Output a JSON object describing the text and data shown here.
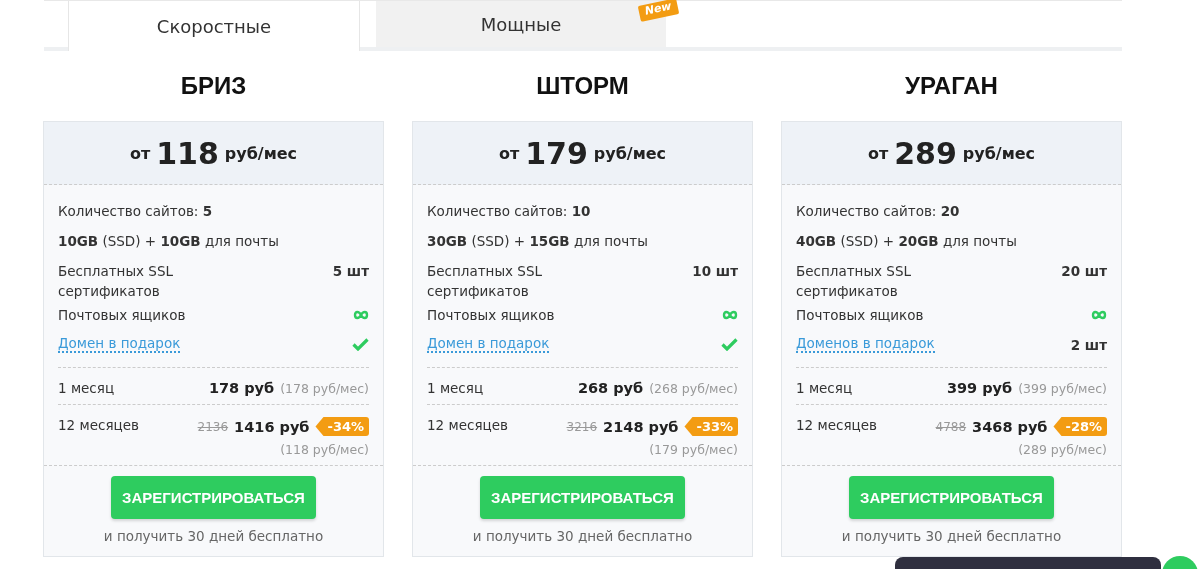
{
  "tabs": [
    {
      "label": "Скоростные",
      "selected": true
    },
    {
      "label": "Мощные",
      "selected": false,
      "badge": "New"
    }
  ],
  "plans": [
    {
      "name": "БРИЗ",
      "price_prefix": "от",
      "price": "118",
      "price_unit": "руб/мес",
      "features": [
        {
          "kind": "inline",
          "label": "Количество сайтов:",
          "value": "5"
        },
        {
          "kind": "text",
          "label": "**10GB** (SSD) + **10GB** для почты"
        },
        {
          "kind": "value",
          "label": "Бесплатных SSL сертификатов",
          "value": "5 шт"
        },
        {
          "kind": "infinity",
          "label": "Почтовых ящиков"
        },
        {
          "kind": "check",
          "label": "Домен в подарок",
          "link": true
        }
      ],
      "month": {
        "label": "1 месяц",
        "price": "178 руб",
        "per_month": "(178 руб/мес)"
      },
      "year": {
        "label": "12 месяцев",
        "old_price": "2136",
        "price": "1416 руб",
        "discount": "-34%",
        "per_month": "(118 руб/мес)"
      },
      "button": "ЗАРЕГИСТРИРОВАТЬСЯ",
      "note": "и получить 30 дней бесплатно"
    },
    {
      "name": "ШТОРМ",
      "price_prefix": "от",
      "price": "179",
      "price_unit": "руб/мес",
      "features": [
        {
          "kind": "inline",
          "label": "Количество сайтов:",
          "value": "10"
        },
        {
          "kind": "text",
          "label": "**30GB** (SSD) + **15GB** для почты"
        },
        {
          "kind": "value",
          "label": "Бесплатных SSL сертификатов",
          "value": "10 шт"
        },
        {
          "kind": "infinity",
          "label": "Почтовых ящиков"
        },
        {
          "kind": "check",
          "label": "Домен в подарок",
          "link": true
        }
      ],
      "month": {
        "label": "1 месяц",
        "price": "268 руб",
        "per_month": "(268 руб/мес)"
      },
      "year": {
        "label": "12 месяцев",
        "old_price": "3216",
        "price": "2148 руб",
        "discount": "-33%",
        "per_month": "(179 руб/мес)"
      },
      "button": "ЗАРЕГИСТРИРОВАТЬСЯ",
      "note": "и получить 30 дней бесплатно"
    },
    {
      "name": "УРАГАН",
      "price_prefix": "от",
      "price": "289",
      "price_unit": "руб/мес",
      "features": [
        {
          "kind": "inline",
          "label": "Количество сайтов:",
          "value": "20"
        },
        {
          "kind": "text",
          "label": "**40GB** (SSD) + **20GB** для почты"
        },
        {
          "kind": "value",
          "label": "Бесплатных SSL сертификатов",
          "value": "20 шт"
        },
        {
          "kind": "infinity",
          "label": "Почтовых ящиков"
        },
        {
          "kind": "value",
          "label": "Доменов в подарок",
          "value": "2 шт",
          "link": true
        }
      ],
      "month": {
        "label": "1 месяц",
        "price": "399 руб",
        "per_month": "(399 руб/мес)"
      },
      "year": {
        "label": "12 месяцев",
        "old_price": "4788",
        "price": "3468 руб",
        "discount": "-28%",
        "per_month": "(289 руб/мес)"
      },
      "button": "ЗАРЕГИСТРИРОВАТЬСЯ",
      "note": "и получить 30 дней бесплатно"
    }
  ]
}
